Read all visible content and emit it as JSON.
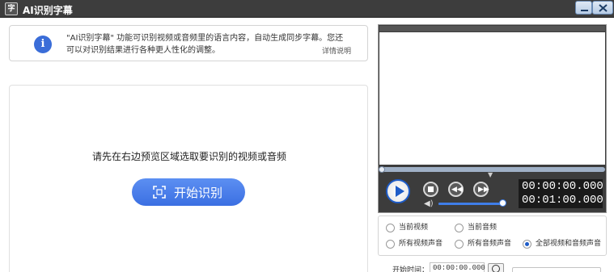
{
  "window": {
    "title": "AI识别字幕",
    "icon_text": "字",
    "minimize_icon": "minimize-icon",
    "close_icon": "close-icon"
  },
  "info": {
    "icon": "info-icon",
    "icon_glyph": "i",
    "text": "\"AI识别字幕\" 功能可识别视频或音频里的语言内容，自动生成同步字幕。您还可以对识别结果进行各种更人性化的调整。",
    "link": "详情说明"
  },
  "main": {
    "prompt": "请先在右边预览区域选取要识别的视频或音频",
    "start_button": "开始识别",
    "start_icon": "scan-icon"
  },
  "player": {
    "current_time": "00:00:00.000",
    "total_time": "00:01:00.000",
    "volume_level": 0.95,
    "progress": 0,
    "icons": [
      "play-icon",
      "stop-icon",
      "previous-icon",
      "next-icon",
      "volume-icon",
      "chevron-down-icon"
    ]
  },
  "source_options": {
    "items": [
      {
        "label": "当前视频",
        "selected": false
      },
      {
        "label": "当前音频",
        "selected": false
      },
      {
        "label": "所有视频声音",
        "selected": false
      },
      {
        "label": "所有音频声音",
        "selected": false
      },
      {
        "label": "全部视频和音频声音",
        "selected": true
      }
    ]
  },
  "start_time": {
    "label": "开始时间：",
    "value": "00:00:00.000",
    "icon": "clock-icon"
  },
  "colors": {
    "accent": "#3b6fe2",
    "titlebar": "#3d3d3d",
    "player_bg": "#3c3c3c"
  }
}
